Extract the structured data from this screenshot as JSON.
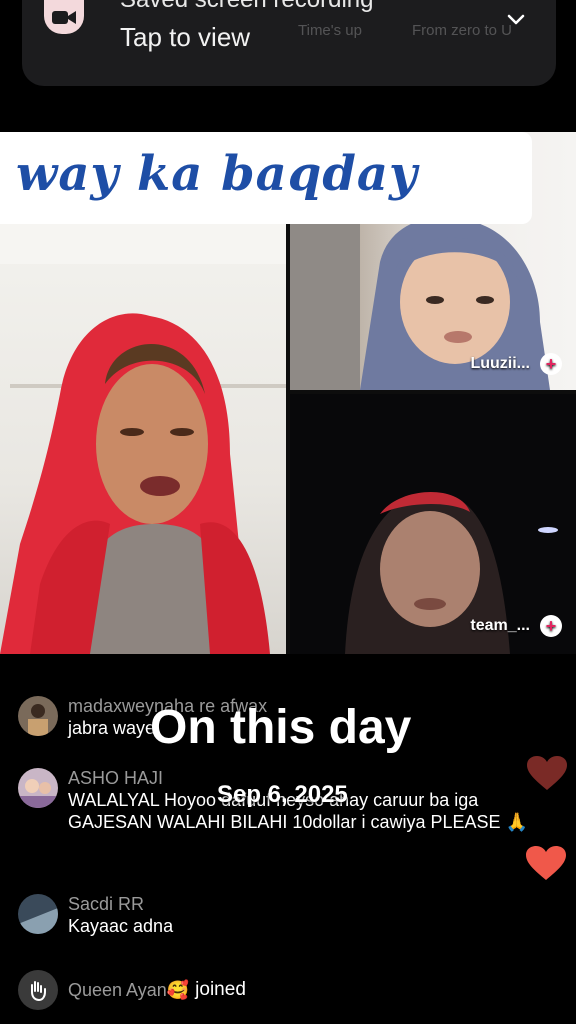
{
  "notification": {
    "title": "Saved screen recording",
    "subtitle": "Tap to view",
    "ghost_items": [
      "Time's up",
      "From zero to U"
    ],
    "icon": "video-camera-icon"
  },
  "live": {
    "title_banner": "way ka baqday",
    "guests": [
      {
        "name": "Luuzii...",
        "action": "+"
      },
      {
        "name": "team_...",
        "action": "+"
      }
    ]
  },
  "comments": [
    {
      "user": "madaxweynaha re afwax",
      "text": "jabra waye"
    },
    {
      "user": "ASHO HAJI",
      "text": "WALALYAL Hoyoo dafuuf neyso ahay caruur ba iga GAJESAN WALAHI BILAHI 10dollar i cawiya PLEASE 🙏"
    },
    {
      "user": "Sacdi RR",
      "text": "Kayaac adna"
    },
    {
      "user": "Queen  Ayan🥰",
      "text": "joined"
    }
  ],
  "overlay": {
    "title": "On this day",
    "date": "Sep 6, 2025"
  },
  "colors": {
    "banner_text": "#1e4ea6",
    "heart_dim": "#7a2a26",
    "heart_bright": "#f0584a",
    "hijab_red": "#e02a3a"
  }
}
